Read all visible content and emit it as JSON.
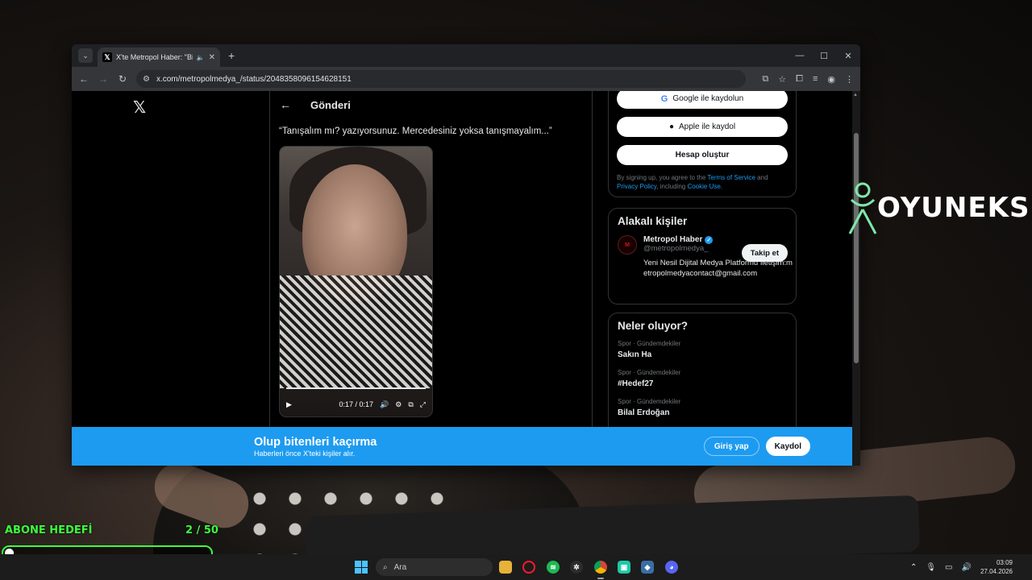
{
  "browser": {
    "tab_title": "X'te Metropol Haber: \"Bir k",
    "tab_favicon": "𝕏",
    "url": "x.com/metropolmedya_/status/2048358096154628151"
  },
  "x": {
    "logo": "𝕏",
    "post_header": "Gönderi",
    "post_text": "“Tanışalım mı? yazıyorsunuz. Mercedesiniz yoksa tanışmayalım...”",
    "video_time": "0:17 / 0:17",
    "video_progress": 1.0
  },
  "signup": {
    "google": "Google ile kaydolun",
    "apple": "Apple ile kaydol",
    "create": "Hesap oluştur",
    "legal_pre": "By signing up, you agree to the ",
    "terms": "Terms of Service",
    "and": " and ",
    "privacy": "Privacy Policy",
    "including": ", including ",
    "cookie": "Cookie Use."
  },
  "related": {
    "title": "Alakalı kişiler",
    "name": "Metropol Haber",
    "handle": "@metropolmedya_",
    "follow": "Takip et",
    "bio": "Yeni Nesil Dijital Medya Platformu İletişim:metropolmedyacontact@gmail.com"
  },
  "trends": {
    "title": "Neler oluyor?",
    "items": [
      {
        "meta": "Spor · Gündemdekiler",
        "name": "Sakın Ha"
      },
      {
        "meta": "Spor · Gündemdekiler",
        "name": "#Hedef27"
      },
      {
        "meta": "Spor · Gündemdekiler",
        "name": "Bilal Erdoğan"
      }
    ]
  },
  "banner": {
    "title": "Olup bitenleri kaçırma",
    "subtitle": "Haberleri önce X'teki kişiler alır.",
    "login": "Giriş yap",
    "signup": "Kaydol"
  },
  "overlay": {
    "brand": "OYUNEKS",
    "goal_label": "ABONE HEDEFİ",
    "goal_count": "2 / 50",
    "goal_progress": 0.04
  },
  "taskbar": {
    "search": "Ara",
    "time": "03:09",
    "date": "27.04.2026"
  },
  "colors": {
    "x_blue": "#1d9bf0",
    "goal_green": "#3cff3c"
  }
}
